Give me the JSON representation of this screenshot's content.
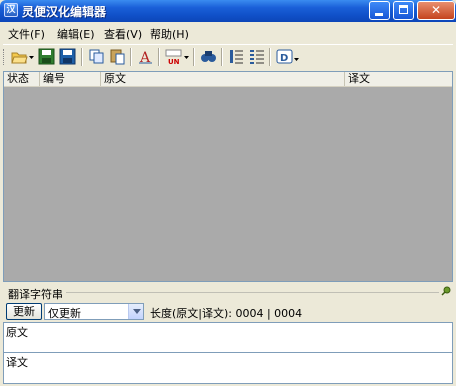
{
  "window": {
    "title": "灵便汉化编辑器"
  },
  "menu": [
    {
      "label": "文件(F)"
    },
    {
      "label": "编辑(E)"
    },
    {
      "label": "查看(V)"
    },
    {
      "label": "帮助(H)"
    }
  ],
  "toolbar": {
    "icons": [
      "open-folder-icon",
      "save-icon",
      "save-as-icon",
      "copy-icon",
      "paste-icon",
      "translate-text-icon",
      "encoding-icon",
      "find-icon",
      "list-numbered-icon",
      "list-details-icon",
      "dialog-icon"
    ],
    "encoding_label": "UN"
  },
  "list": {
    "columns": [
      {
        "label": "状态"
      },
      {
        "label": "编号"
      },
      {
        "label": "原文"
      },
      {
        "label": "译文"
      }
    ]
  },
  "bottom": {
    "group_title": "翻译字符串",
    "update_button": "更新",
    "mode_select": "仅更新",
    "length_text": "长度(原文|译文): 0004 | 0004",
    "original_label": "原文",
    "translation_label": "译文"
  },
  "colors": {
    "title_bar": "#1050c8",
    "list_background": "#aaaaaa",
    "window_face": "#ece9d8"
  }
}
